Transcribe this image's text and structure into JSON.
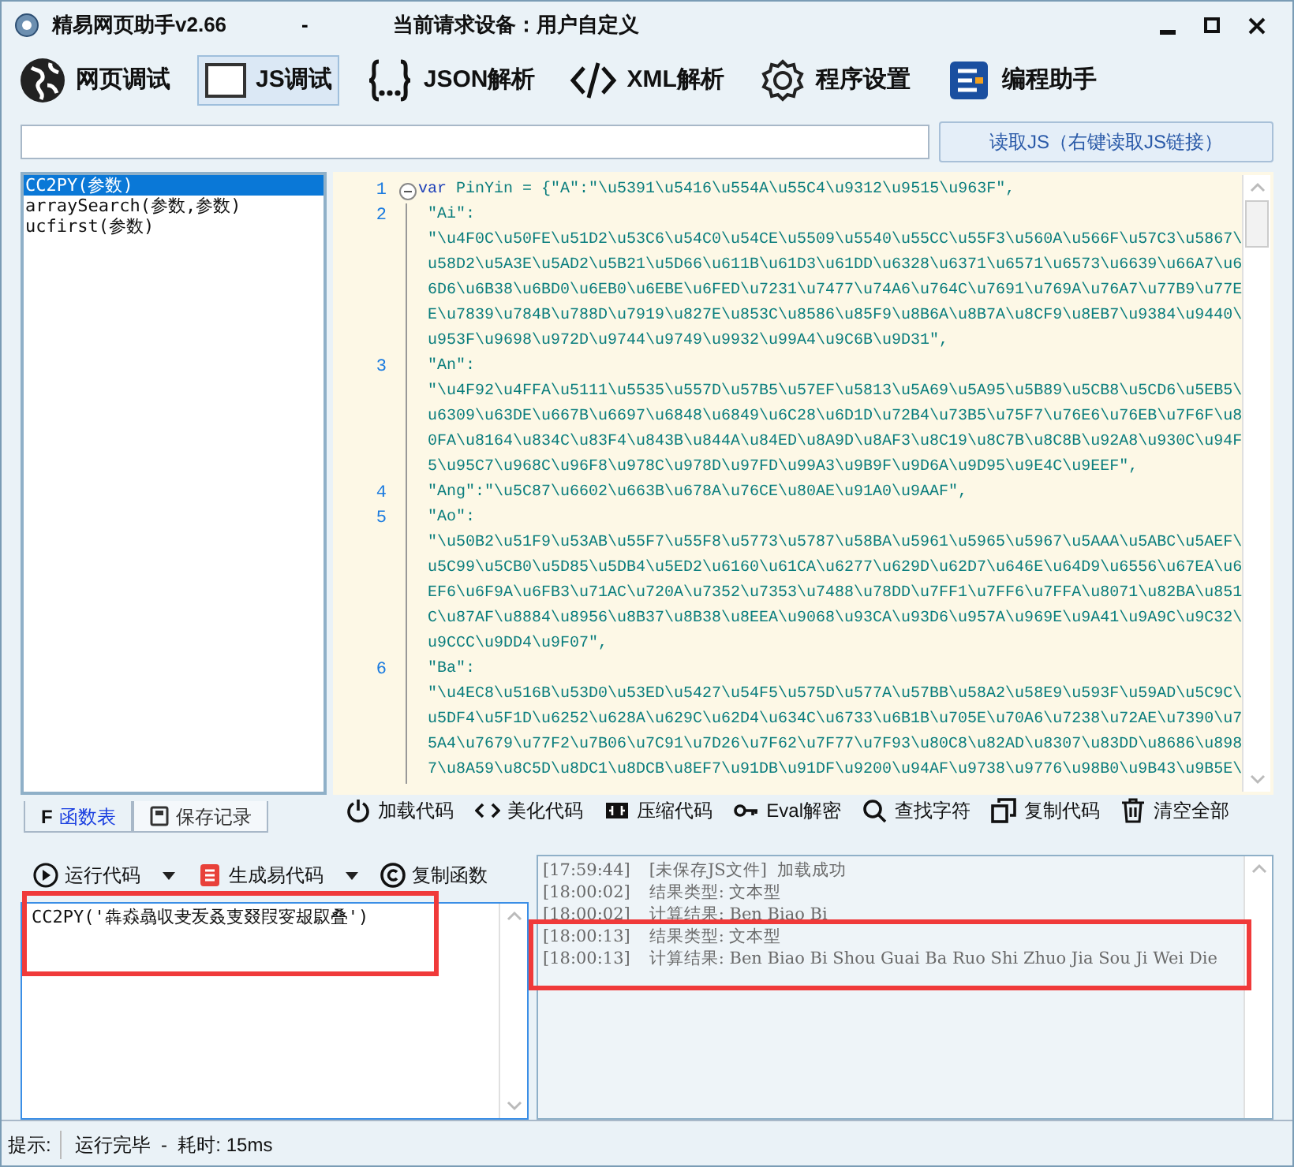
{
  "window": {
    "title": "精易网页助手v2.66",
    "separator": "-",
    "device": "当前请求设备：用户自定义"
  },
  "toolbar": [
    {
      "label": "网页调试",
      "selected": false
    },
    {
      "label": "JS调试",
      "selected": true
    },
    {
      "label": "JSON解析",
      "selected": false
    },
    {
      "label": "XML解析",
      "selected": false
    },
    {
      "label": "程序设置",
      "selected": false
    },
    {
      "label": "编程助手",
      "selected": false
    }
  ],
  "load_button": "读取JS（右键读取JS链接）",
  "functions": [
    {
      "label": "CC2PY(参数)",
      "selected": true
    },
    {
      "label": "arraySearch(参数,参数)",
      "selected": false
    },
    {
      "label": "ucfirst(参数)",
      "selected": false
    }
  ],
  "editor": {
    "lines": [
      {
        "number": "1",
        "keyword": "var",
        "text": [
          "PinYin = {\"A\":\"\\u5391\\u5416\\u554A\\u55C4\\u9312\\u9515\\u963F\","
        ]
      },
      {
        "number": "2",
        "text": [
          "\"Ai\":",
          "\"\\u4F0C\\u50FE\\u51D2\\u53C6\\u54C0\\u54CE\\u5509\\u5540\\u55CC\\u55F3\\u560A\\u566F\\u57C3\\u5867\\u58D2\\u5A3E\\u5AD2\\u5B21\\u5D66\\u611B\\u61D3\\u61DD\\u6328\\u6371\\u6571\\u6573\\u6639\\u66A7\\u66D6\\u6B38\\u6BD0\\u6EB0\\u6EBE\\u6FED\\u7231\\u7477\\u74A6\\u764C\\u7691\\u769A\\u76A7\\u77B9\\u77EE\\u7839\\u784B\\u788D\\u7919\\u827E\\u853C\\u8586\\u85F9\\u8B6A\\u8B7A\\u8CF9\\u8EB7\\u9384\\u9440\\u953F\\u9698\\u972D\\u9744\\u9749\\u9932\\u99A4\\u9C6B\\u9D31\","
        ]
      },
      {
        "number": "3",
        "text": [
          "\"An\":",
          "\"\\u4F92\\u4FFA\\u5111\\u5535\\u557D\\u57B5\\u57EF\\u5813\\u5A69\\u5A95\\u5B89\\u5CB8\\u5CD6\\u5EB5\\u6309\\u63DE\\u667B\\u6697\\u6848\\u6849\\u6C28\\u6D1D\\u72B4\\u73B5\\u75F7\\u76E6\\u76EB\\u7F6F\\u80FA\\u8164\\u834C\\u83F4\\u843B\\u844A\\u84ED\\u8A9D\\u8AF3\\u8C19\\u8C7B\\u8C8B\\u92A8\\u930C\\u94F5\\u95C7\\u968C\\u96F8\\u978C\\u978D\\u97FD\\u99A3\\u9B9F\\u9D6A\\u9D95\\u9E4C\\u9EEF\","
        ]
      },
      {
        "number": "4",
        "text": [
          "\"Ang\":\"\\u5C87\\u6602\\u663B\\u678A\\u76CE\\u80AE\\u91A0\\u9AAF\","
        ]
      },
      {
        "number": "5",
        "text": [
          "\"Ao\":",
          "\"\\u50B2\\u51F9\\u53AB\\u55F7\\u55F8\\u5773\\u5787\\u58BA\\u5961\\u5965\\u5967\\u5AAA\\u5ABC\\u5AEF\\u5C99\\u5CB0\\u5D85\\u5DB4\\u5ED2\\u6160\\u61CA\\u6277\\u629D\\u62D7\\u646E\\u64D9\\u6556\\u67EA\\u6EF6\\u6F9A\\u6FB3\\u71AC\\u720A\\u7352\\u7353\\u7488\\u78DD\\u7FF1\\u7FF6\\u7FFA\\u8071\\u82BA\\u851C\\u87AF\\u8884\\u8956\\u8B37\\u8B38\\u8EEA\\u9068\\u93CA\\u93D6\\u957A\\u969E\\u9A41\\u9A9C\\u9C32\\u9CCC\\u9DD4\\u9F07\","
        ]
      },
      {
        "number": "6",
        "text": [
          "\"Ba\":",
          "\"\\u4EC8\\u516B\\u53D0\\u53ED\\u5427\\u54F5\\u575D\\u577A\\u57BB\\u58A2\\u58E9\\u593F\\u59AD\\u5C9C\\u5DF4\\u5F1D\\u6252\\u628A\\u629C\\u62D4\\u634C\\u6733\\u6B1B\\u705E\\u70A6\\u7238\\u72AE\\u7390\\u75A4\\u7679\\u77F2\\u7B06\\u7C91\\u7D26\\u7F62\\u7F77\\u7F93\\u80C8\\u82AD\\u8307\\u83DD\\u8686\\u8987\\u8A59\\u8C5D\\u8DC1\\u8DCB\\u8EF7\\u91DB\\u91DF\\u9200\\u94AF\\u9738\\u9776\\u98B0\\u9B43\\u9B5E\\"
        ]
      }
    ]
  },
  "panel_tabs": [
    {
      "icon_letter": "F",
      "label": "函数表",
      "selected": true
    },
    {
      "label": "保存记录",
      "selected": false
    }
  ],
  "actions": [
    "加载代码",
    "美化代码",
    "压缩代码",
    "Eval解密",
    "查找字符",
    "复制代码",
    "清空全部"
  ],
  "run_buttons": [
    "运行代码",
    "生成易代码",
    "复制函数"
  ],
  "script_input": "CC2PY('犇猋骉収叏叐叒叓叕叚叜叝叞叠')",
  "log": [
    {
      "time": "[17:59:44]",
      "message": "[未保存JS文件]  加载成功"
    },
    {
      "time": "[18:00:02]",
      "message": "结果类型: 文本型"
    },
    {
      "time": "[18:00:02]",
      "message": "计算结果: Ben Biao Bi"
    },
    {
      "time": "[18:00:13]",
      "message": "结果类型: 文本型"
    },
    {
      "time": "[18:00:13]",
      "message": "计算结果: Ben Biao Bi Shou Guai Ba Ruo Shi Zhuo Jia Sou Ji Wei Die"
    }
  ],
  "status_bar": {
    "label": "提示:",
    "message": "运行完毕  -  耗时: 15ms"
  }
}
